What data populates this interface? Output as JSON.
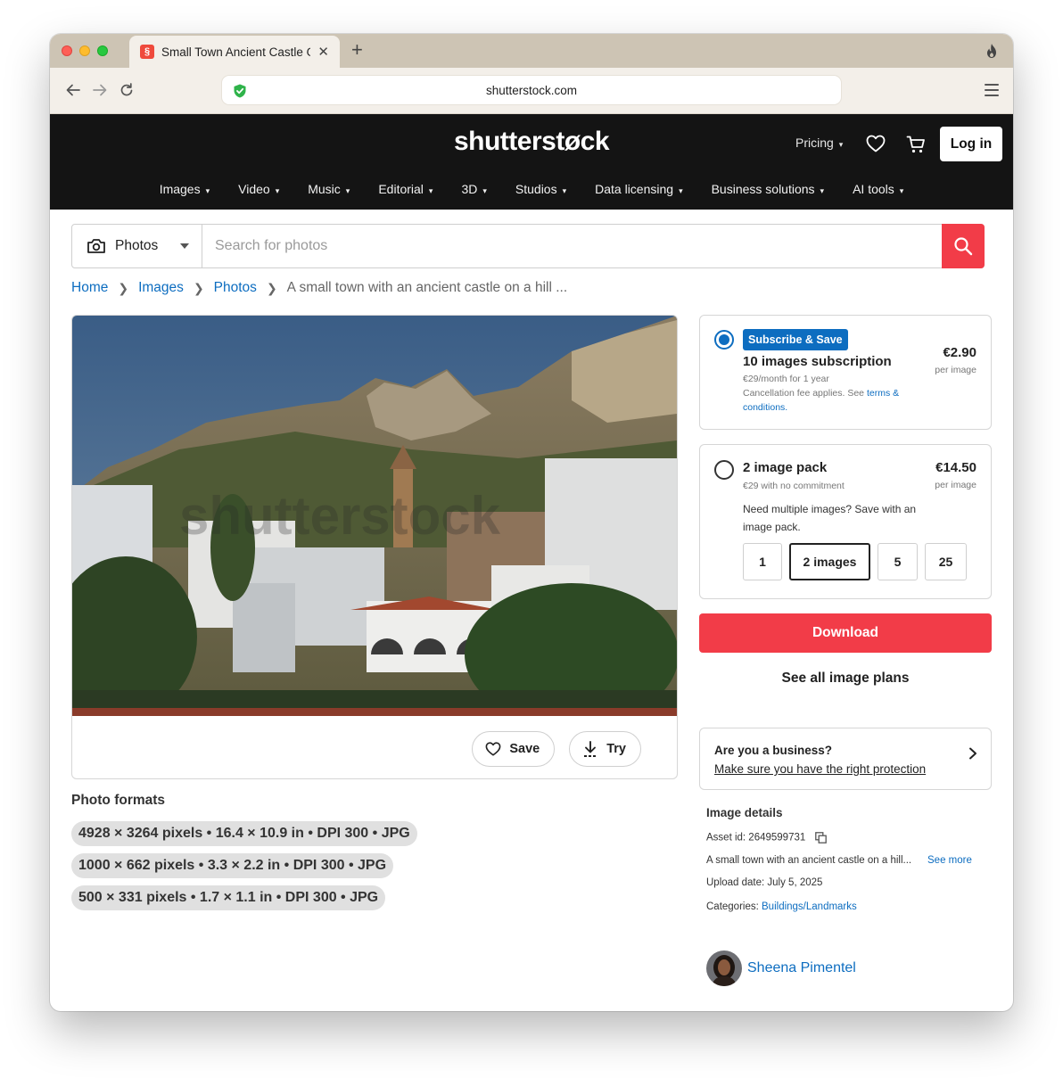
{
  "browser": {
    "tab_title": "Small Town Ancient Castle O",
    "tab_favicon": "§",
    "tab_close": "✕",
    "new_tab": "+",
    "url": "shutterstock.com"
  },
  "header": {
    "logo": "shutterstøck",
    "pricing": "Pricing",
    "login": "Log in",
    "nav": [
      "Images",
      "Video",
      "Music",
      "Editorial",
      "3D",
      "Studios",
      "Data licensing",
      "Business solutions",
      "AI tools"
    ]
  },
  "search": {
    "type": "Photos",
    "placeholder": "Search for photos"
  },
  "breadcrumb": {
    "items": [
      "Home",
      "Images",
      "Photos"
    ],
    "current": "A small town with an ancient castle on a hill ..."
  },
  "image_card": {
    "watermark": "shutterstock",
    "save": "Save",
    "try": "Try"
  },
  "formats": {
    "title": "Photo formats",
    "items": [
      "4928 × 3264 pixels • 16.4 × 10.9 in • DPI 300 • JPG",
      "1000 × 662 pixels • 3.3 × 2.2 in • DPI 300 • JPG",
      "500 × 331 pixels • 1.7 × 1.1 in • DPI 300 • JPG"
    ]
  },
  "plans": {
    "subscription": {
      "badge": "Subscribe & Save",
      "title": "10 images subscription",
      "sub1": "€29/month for 1 year",
      "sub2": "Cancellation fee applies. See",
      "sub2_link": "terms & conditions.",
      "price": "€2.90",
      "per": "per image"
    },
    "pack": {
      "title": "2 image pack",
      "sub": "€29 with no commitment",
      "price": "€14.50",
      "per": "per image",
      "desc": "Need multiple images? Save with an image pack.",
      "options": [
        "1",
        "2 images",
        "5",
        "25"
      ],
      "selected": "2 images"
    },
    "download": "Download",
    "see_all": "See all image plans"
  },
  "business": {
    "title": "Are you a business?",
    "link": "Make sure you have the right protection"
  },
  "details": {
    "title": "Image details",
    "asset_id": "Asset id: 2649599731",
    "description": "A small town with an ancient castle on a hill...",
    "see_more": "See more",
    "upload_date": "Upload date: July 5, 2025",
    "categories_label": "Categories:",
    "categories_value": "Buildings/Landmarks"
  },
  "author": {
    "name": "Sheena Pimentel"
  },
  "colors": {
    "accent_red": "#f23c48",
    "link_blue": "#0d6dc0",
    "header_bg": "#141414"
  }
}
